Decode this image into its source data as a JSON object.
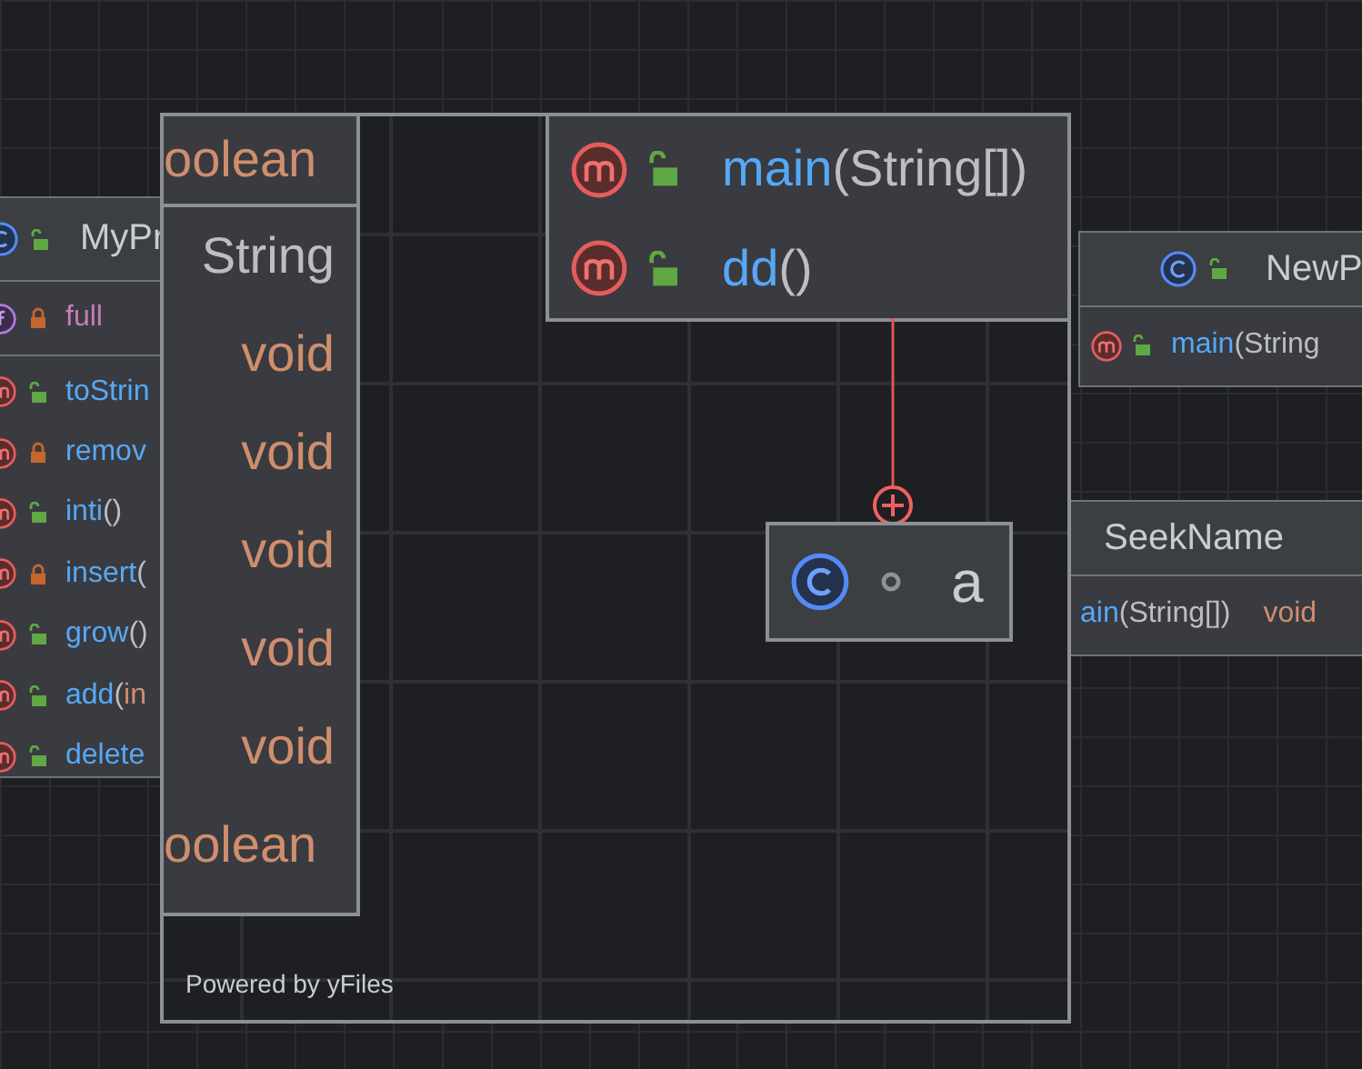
{
  "left_class": {
    "name": "MyPr",
    "kind": "public",
    "fields": [
      {
        "name": "full",
        "kind": "private"
      }
    ],
    "methods": [
      {
        "name": "toStrin",
        "kind": "public"
      },
      {
        "name": "remov",
        "kind": "private"
      },
      {
        "name": "inti",
        "args": "()",
        "kind": "public"
      },
      {
        "name": "insert",
        "args": "(",
        "kind": "private"
      },
      {
        "name": "grow",
        "args": "()",
        "kind": "public"
      },
      {
        "name": "add",
        "args": "(",
        "type": "in",
        "kind": "public"
      },
      {
        "name": "delete",
        "kind": "public"
      }
    ]
  },
  "magnifier": {
    "type_column": {
      "header": "oolean",
      "types": [
        {
          "text": "String",
          "kind": "reference"
        },
        {
          "text": "void",
          "kind": "primitive"
        },
        {
          "text": "void",
          "kind": "primitive"
        },
        {
          "text": "void",
          "kind": "primitive"
        },
        {
          "text": "void",
          "kind": "primitive"
        },
        {
          "text": "void",
          "kind": "primitive"
        },
        {
          "text": "oolean",
          "kind": "primitive"
        }
      ]
    },
    "method_node": {
      "methods": [
        {
          "name": "main",
          "args": "(String[])",
          "kind": "public"
        },
        {
          "name": "dd",
          "args": "()",
          "kind": "public"
        }
      ]
    },
    "class_node": {
      "name": "a",
      "kind": "package"
    },
    "footer": "Powered by yFiles"
  },
  "right_classes": [
    {
      "name": "NewP",
      "kind": "public",
      "methods": [
        {
          "name": "main",
          "args": "(String",
          "kind": "public"
        }
      ]
    },
    {
      "name": "SeekName",
      "methods": [
        {
          "name": "ain",
          "args": "(String[])",
          "type": "void"
        }
      ]
    }
  ]
}
